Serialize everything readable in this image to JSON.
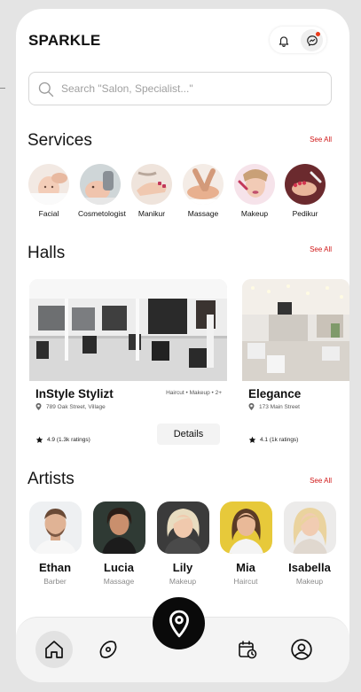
{
  "app": {
    "brand": "SPARKLE",
    "accent": "#d01717",
    "notification_dot": "#ea3a1a"
  },
  "search": {
    "placeholder": "Search \"Salon, Specialist...\""
  },
  "services": {
    "title": "Services",
    "see_all": "See All",
    "items": [
      {
        "label": "Facial",
        "icon": "facial-photo"
      },
      {
        "label": "Cosmetologist",
        "icon": "cosmetologist-photo"
      },
      {
        "label": "Manikur",
        "icon": "manicure-photo"
      },
      {
        "label": "Massage",
        "icon": "massage-photo"
      },
      {
        "label": "Makeup",
        "icon": "makeup-photo"
      },
      {
        "label": "Pedikur",
        "icon": "pedicure-photo"
      }
    ]
  },
  "halls": {
    "title": "Halls",
    "see_all": "See All",
    "details_label": "Details",
    "items": [
      {
        "name": "InStyle Stylizt",
        "tags": "Haircut • Makeup • 2+",
        "address": "789 Oak Street, Village",
        "rating": "4.9 (1.3k ratings)"
      },
      {
        "name": "Elegance",
        "address": "173 Main Street",
        "rating": "4.1 (1k ratings)"
      }
    ]
  },
  "artists": {
    "title": "Artists",
    "see_all": "See All",
    "items": [
      {
        "name": "Ethan",
        "role": "Barber"
      },
      {
        "name": "Lucia",
        "role": "Massage"
      },
      {
        "name": "Lily",
        "role": "Makeup"
      },
      {
        "name": "Mia",
        "role": "Haircut"
      },
      {
        "name": "Isabella",
        "role": "Makeup"
      }
    ]
  },
  "nav": {
    "items": [
      "home-icon",
      "compass-icon",
      "map-pin-icon",
      "calendar-clock-icon",
      "user-icon"
    ]
  }
}
